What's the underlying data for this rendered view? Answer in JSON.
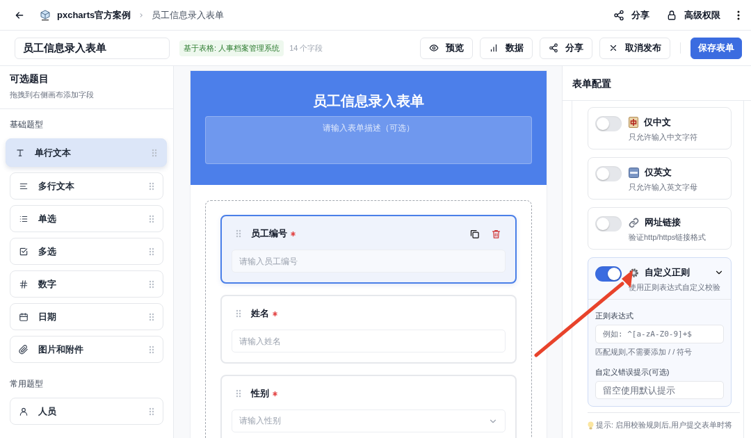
{
  "topbar": {
    "org": "pxcharts官方案例",
    "page": "员工信息录入表单",
    "actions": [
      {
        "kind": "share",
        "label": "分享"
      },
      {
        "kind": "lock",
        "label": "高级权限"
      }
    ]
  },
  "toolbar": {
    "title_value": "员工信息录入表单",
    "source_badge": "基于表格: 人事档案管理系统",
    "field_count": "14 个字段",
    "buttons": [
      {
        "kind": "preview",
        "label": "预览"
      },
      {
        "kind": "data",
        "label": "数据"
      },
      {
        "kind": "share",
        "label": "分享"
      },
      {
        "kind": "unpublish",
        "label": "取消发布"
      },
      {
        "kind": "save",
        "label": "保存表单"
      }
    ]
  },
  "palette": {
    "title": "可选题目",
    "subtitle": "拖拽到右侧画布添加字段",
    "groups": [
      {
        "title": "基础题型",
        "items": [
          {
            "kind": "single_line",
            "label": "单行文本",
            "selected": true
          },
          {
            "kind": "multi_line",
            "label": "多行文本",
            "selected": false
          },
          {
            "kind": "radio",
            "label": "单选",
            "selected": false
          },
          {
            "kind": "checkbox",
            "label": "多选",
            "selected": false
          },
          {
            "kind": "number",
            "label": "数字",
            "selected": false
          },
          {
            "kind": "date",
            "label": "日期",
            "selected": false
          },
          {
            "kind": "attachment",
            "label": "图片和附件",
            "selected": false
          }
        ]
      },
      {
        "title": "常用题型",
        "items": [
          {
            "kind": "person",
            "label": "人员",
            "selected": false
          }
        ]
      }
    ]
  },
  "form": {
    "title": "员工信息录入表单",
    "description_placeholder": "请输入表单描述（可选）",
    "fields": [
      {
        "kind": "text",
        "label": "员工编号",
        "required": true,
        "placeholder": "请输入员工编号",
        "selected": true
      },
      {
        "kind": "text",
        "label": "姓名",
        "required": true,
        "placeholder": "请输入姓名",
        "selected": false
      },
      {
        "kind": "select",
        "label": "性别",
        "required": true,
        "placeholder": "请输入性别",
        "selected": false
      }
    ]
  },
  "config": {
    "title": "表单配置",
    "rules": [
      {
        "kind": "chinese",
        "label": "仅中文",
        "description": "只允许输入中文字符",
        "on": false,
        "expanded": false
      },
      {
        "kind": "english",
        "label": "仅英文",
        "description": "只允许输入英文字母",
        "on": false,
        "expanded": false
      },
      {
        "kind": "url",
        "label": "网址链接",
        "description": "验证http/https链接格式",
        "on": false,
        "expanded": false
      },
      {
        "kind": "custom",
        "label": "自定义正则",
        "description": "使用正则表达式自定义校验",
        "on": true,
        "expanded": true,
        "details": {
          "regex_label": "正则表达式",
          "regex_placeholder": "例如: ^[a-zA-Z0-9]+$",
          "regex_hint": "匹配规则,不需要添加 / / 符号",
          "error_label": "自定义错误提示(可选)",
          "error_placeholder": "留空使用默认提示"
        }
      }
    ],
    "tip": "提示: 启用校验规则后,用户提交表单时将"
  }
}
